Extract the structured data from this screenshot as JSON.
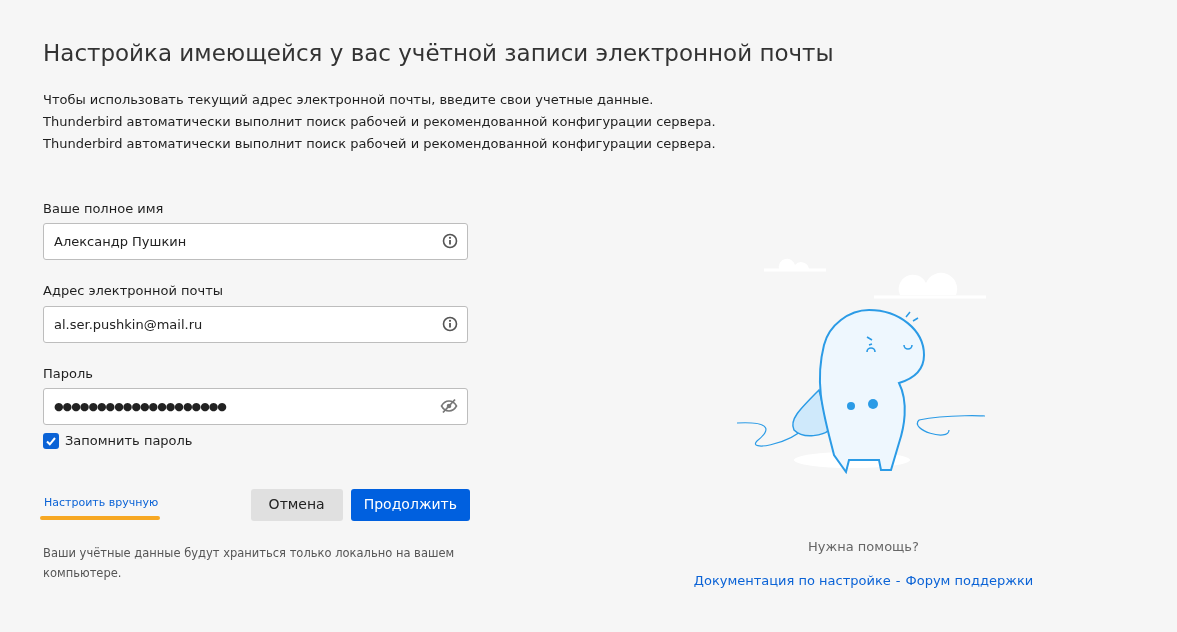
{
  "title": "Настройка имеющейся у вас учётной записи электронной почты",
  "description": [
    "Чтобы использовать текущий адрес электронной почты, введите свои учетные данные.",
    "Thunderbird автоматически выполнит поиск рабочей и рекомендованной конфигурации сервера.",
    "Thunderbird автоматически выполнит поиск рабочей и рекомендованной конфигурации сервера."
  ],
  "fields": [
    {
      "kind": "info",
      "label": "Ваше полное имя",
      "value": "Александр Пушкин"
    },
    {
      "kind": "info",
      "label": "Адрес электронной почты",
      "value": "al.ser.pushkin@mail.ru"
    },
    {
      "kind": "password",
      "label": "Пароль",
      "value": "●●●●●●●●●●●●●●●●●●●●"
    }
  ],
  "remember_password": {
    "label": "Запомнить пароль",
    "checked": true
  },
  "manual_link": "Настроить вручную",
  "buttons": [
    {
      "label": "Отмена",
      "kind": "secondary"
    },
    {
      "label": "Продолжить",
      "kind": "primary"
    }
  ],
  "storage_note": "Ваши учётные данные будут храниться только локально на вашем компьютере.",
  "help": {
    "question": "Нужна помощь?",
    "links": [
      "Документация по настройке",
      "Форум поддержки"
    ],
    "separator": "-"
  }
}
